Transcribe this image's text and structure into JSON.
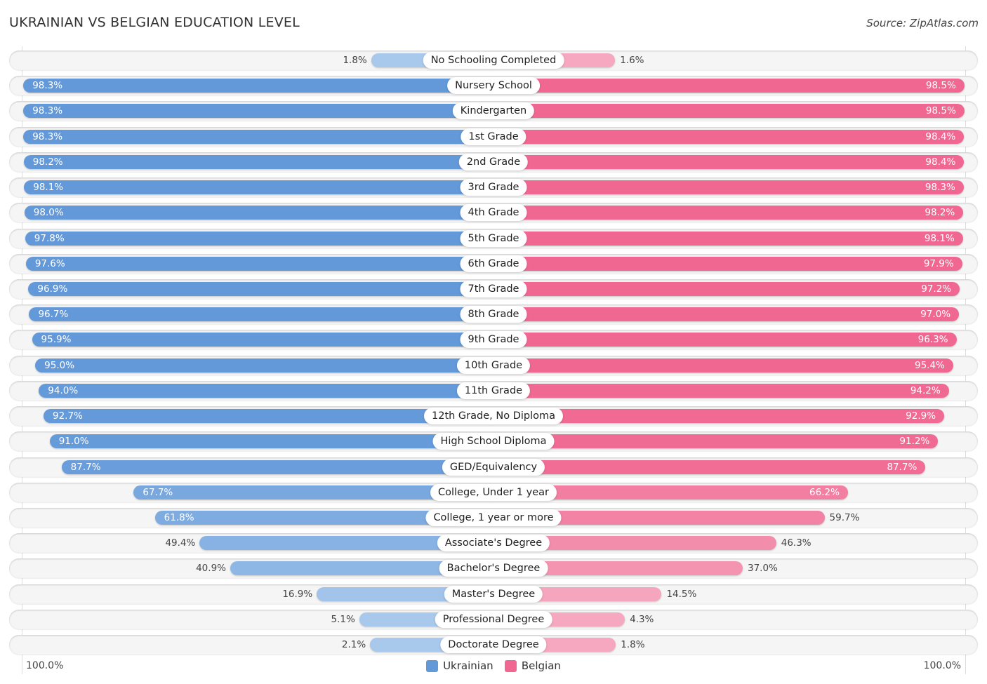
{
  "header": {
    "title": "UKRAINIAN VS BELGIAN EDUCATION LEVEL",
    "source": "Source: ZipAtlas.com"
  },
  "colors": {
    "ukrainian": "#6399d9",
    "ukrainian_light": "#a8c8ec",
    "belgian": "#f06892",
    "belgian_light": "#f6a8c0"
  },
  "chart_data": {
    "type": "bar",
    "orientation": "horizontal-diverging",
    "title": "UKRAINIAN VS BELGIAN EDUCATION LEVEL",
    "xlabel": "",
    "ylabel": "",
    "xlim": [
      0,
      100
    ],
    "axis_labels": {
      "left": "100.0%",
      "right": "100.0%"
    },
    "legend_position": "bottom-center",
    "categories": [
      "No Schooling Completed",
      "Nursery School",
      "Kindergarten",
      "1st Grade",
      "2nd Grade",
      "3rd Grade",
      "4th Grade",
      "5th Grade",
      "6th Grade",
      "7th Grade",
      "8th Grade",
      "9th Grade",
      "10th Grade",
      "11th Grade",
      "12th Grade, No Diploma",
      "High School Diploma",
      "GED/Equivalency",
      "College, Under 1 year",
      "College, 1 year or more",
      "Associate's Degree",
      "Bachelor's Degree",
      "Master's Degree",
      "Professional Degree",
      "Doctorate Degree"
    ],
    "series": [
      {
        "name": "Ukrainian",
        "side": "left",
        "values": [
          1.8,
          98.3,
          98.3,
          98.3,
          98.2,
          98.1,
          98.0,
          97.8,
          97.6,
          96.9,
          96.7,
          95.9,
          95.0,
          94.0,
          92.7,
          91.0,
          87.7,
          67.7,
          61.8,
          49.4,
          40.9,
          16.9,
          5.1,
          2.1
        ],
        "labels": [
          "1.8%",
          "98.3%",
          "98.3%",
          "98.3%",
          "98.2%",
          "98.1%",
          "98.0%",
          "97.8%",
          "97.6%",
          "96.9%",
          "96.7%",
          "95.9%",
          "95.0%",
          "94.0%",
          "92.7%",
          "91.0%",
          "87.7%",
          "67.7%",
          "61.8%",
          "49.4%",
          "40.9%",
          "16.9%",
          "5.1%",
          "2.1%"
        ]
      },
      {
        "name": "Belgian",
        "side": "right",
        "values": [
          1.6,
          98.5,
          98.5,
          98.4,
          98.4,
          98.3,
          98.2,
          98.1,
          97.9,
          97.2,
          97.0,
          96.3,
          95.4,
          94.2,
          92.9,
          91.2,
          87.7,
          66.2,
          59.7,
          46.3,
          37.0,
          14.5,
          4.3,
          1.8
        ],
        "labels": [
          "1.6%",
          "98.5%",
          "98.5%",
          "98.4%",
          "98.4%",
          "98.3%",
          "98.2%",
          "98.1%",
          "97.9%",
          "97.2%",
          "97.0%",
          "96.3%",
          "95.4%",
          "94.2%",
          "92.9%",
          "91.2%",
          "87.7%",
          "66.2%",
          "59.7%",
          "46.3%",
          "37.0%",
          "14.5%",
          "4.3%",
          "1.8%"
        ]
      }
    ]
  },
  "legend": {
    "items": [
      {
        "label": "Ukrainian"
      },
      {
        "label": "Belgian"
      }
    ]
  }
}
